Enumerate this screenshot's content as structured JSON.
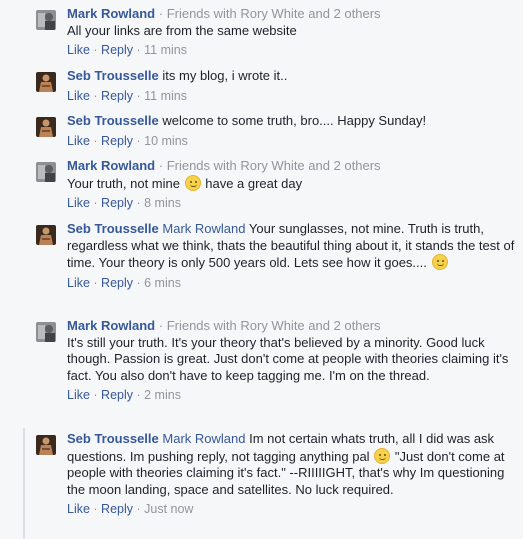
{
  "comments": [
    {
      "author": "Mark Rowland",
      "sep": " · ",
      "meta": "Friends with Rory White and 2 others",
      "text": "All your links are from the same website",
      "like": "Like",
      "reply": "Reply",
      "time": "11 mins"
    },
    {
      "author": "Seb Trousselle",
      "text": "its my blog, i wrote it..",
      "like": "Like",
      "reply": "Reply",
      "time": "11 mins"
    },
    {
      "author": "Seb Trousselle",
      "text": "welcome to some truth, bro.... Happy Sunday!",
      "like": "Like",
      "reply": "Reply",
      "time": "10 mins"
    },
    {
      "author": "Mark Rowland",
      "sep": " · ",
      "meta": "Friends with Rory White and 2 others",
      "text_a": "Your truth, not mine",
      "text_b": "have a great day",
      "like": "Like",
      "reply": "Reply",
      "time": "8 mins"
    },
    {
      "author": "Seb Trousselle",
      "tag": "Mark Rowland",
      "text": "Your sunglasses, not mine. Truth is truth, regardless what we think, thats the beautiful thing about it, it stands the test of time. Your theory is only 500 years old. Lets see how it goes....",
      "like": "Like",
      "reply": "Reply",
      "time": "6 mins"
    },
    {
      "author": "Mark Rowland",
      "sep": " · ",
      "meta": "Friends with Rory White and 2 others",
      "text": "It's still your truth. It's your theory that's believed by a minority. Good luck though. Passion is great. Just don't come at people with theories claiming it's fact. You also don't have to keep tagging me. I'm on the thread.",
      "like": "Like",
      "reply": "Reply",
      "time": "2 mins"
    },
    {
      "author": "Seb Trousselle",
      "tag": "Mark Rowland",
      "text_a": "Im not certain whats truth, all I did was ask questions. Im pushing reply, not tagging anything pal",
      "text_b": "\"Just don't come at people with theories claiming it's fact.\" --RIIIIIGHT, that's why Im questioning the moon landing, space and satellites. No luck required.",
      "like": "Like",
      "reply": "Reply",
      "time": "Just now"
    }
  ],
  "action_sep": " · "
}
